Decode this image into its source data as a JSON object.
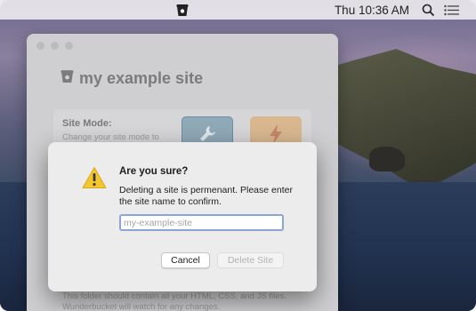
{
  "menubar": {
    "app_icon": "bucket-icon",
    "clock": "Thu 10:36 AM",
    "search_icon": "search-icon",
    "notification_icon": "list-icon"
  },
  "window": {
    "title": "my example site",
    "title_icon": "bucket-icon",
    "site_mode_label": "Site Mode:",
    "site_mode_desc": "Change your site mode to",
    "static_mode_icon": "wrench-icon",
    "dynamic_mode_icon": "bolt-icon",
    "folder_note": "This folder should contain all your HTML, CSS, and JS files. Wunderbucket will watch for any changes."
  },
  "dialog": {
    "icon": "warning-icon",
    "title": "Are you sure?",
    "message": "Deleting a site is permenant. Please enter the site name to confirm.",
    "input_value": "",
    "input_placeholder": "my-example-site",
    "cancel_label": "Cancel",
    "delete_label": "Delete Site"
  },
  "colors": {
    "focus_ring": "#8ba5d9",
    "warning_yellow": "#f4c62d"
  }
}
